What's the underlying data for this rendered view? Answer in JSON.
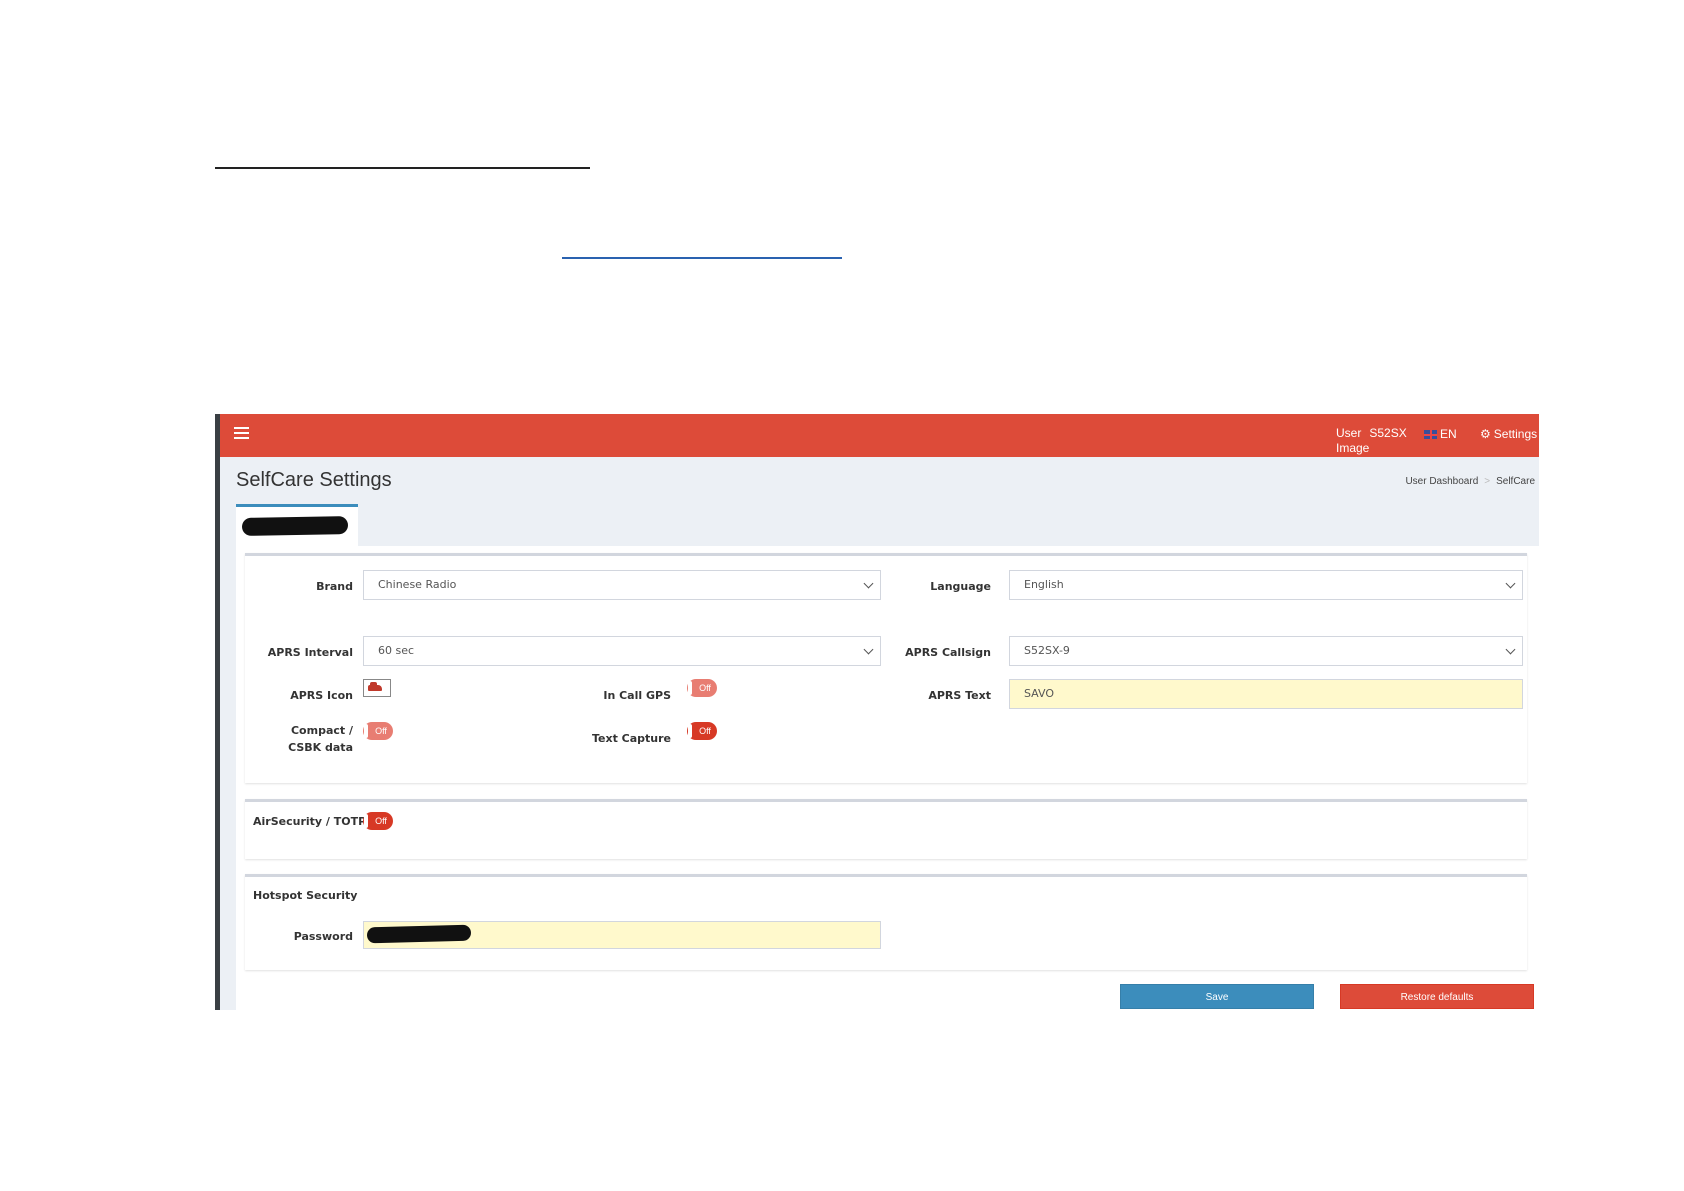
{
  "topbar": {
    "user_label": "User",
    "user_id": "S52SX",
    "image_label": "Image",
    "language": "EN",
    "settings_label": "Settings"
  },
  "page": {
    "title": "SelfCare Settings",
    "breadcrumb": [
      "User Dashboard",
      "SelfCare"
    ]
  },
  "form": {
    "brand": {
      "label": "Brand",
      "value": "Chinese Radio"
    },
    "language": {
      "label": "Language",
      "value": "English"
    },
    "aprs_interval": {
      "label": "APRS Interval",
      "value": "60 sec"
    },
    "aprs_callsign": {
      "label": "APRS Callsign",
      "value": "S52SX-9"
    },
    "aprs_icon": {
      "label": "APRS Icon",
      "icon": "car-icon"
    },
    "in_call_gps": {
      "label": "In Call GPS",
      "state": "Off"
    },
    "aprs_text": {
      "label": "APRS Text",
      "value": "SAVO"
    },
    "compact_csbk": {
      "label_line1": "Compact /",
      "label_line2": "CSBK data",
      "state": "Off"
    },
    "text_capture": {
      "label": "Text Capture",
      "state": "Off"
    },
    "air_security": {
      "label": "AirSecurity / TOTP",
      "state": "Off"
    },
    "hotspot_security": {
      "title": "Hotspot Security",
      "password_label": "Password"
    }
  },
  "buttons": {
    "save": "Save",
    "restore": "Restore defaults"
  },
  "colors": {
    "header": "#dd4b39",
    "primary": "#3c8dbc",
    "danger": "#dd4b39",
    "highlight_field": "#fff9cc"
  }
}
